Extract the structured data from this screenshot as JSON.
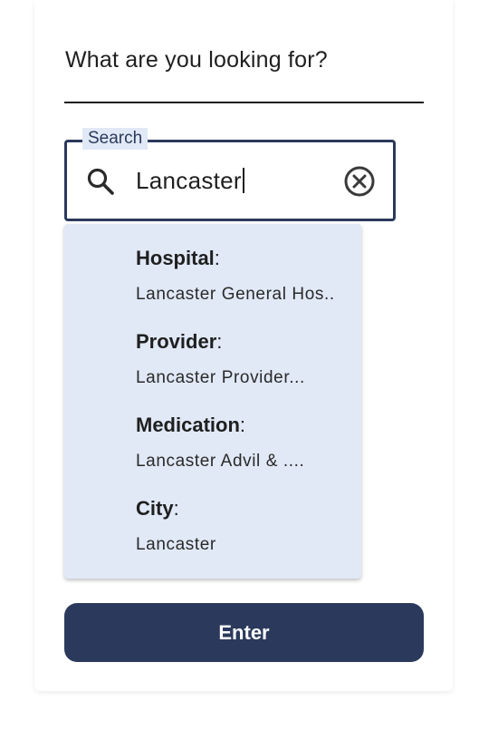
{
  "header": {
    "title": "What are you looking for?"
  },
  "search": {
    "legend": "Search",
    "value": "Lancaster",
    "icon": "search-icon",
    "clear_icon": "clear-circle-icon"
  },
  "suggestions": [
    {
      "type": "Hospital",
      "value": "Lancaster General Hos.."
    },
    {
      "type": "Provider",
      "value": "Lancaster Provider..."
    },
    {
      "type": "Medication",
      "value": "Lancaster Advil & ...."
    },
    {
      "type": "City",
      "value": "Lancaster"
    }
  ],
  "actions": {
    "enter_label": "Enter"
  },
  "colors": {
    "primary": "#2b3a5c",
    "dropdown_bg": "#e1e9f7",
    "text": "#1f1f1f"
  }
}
